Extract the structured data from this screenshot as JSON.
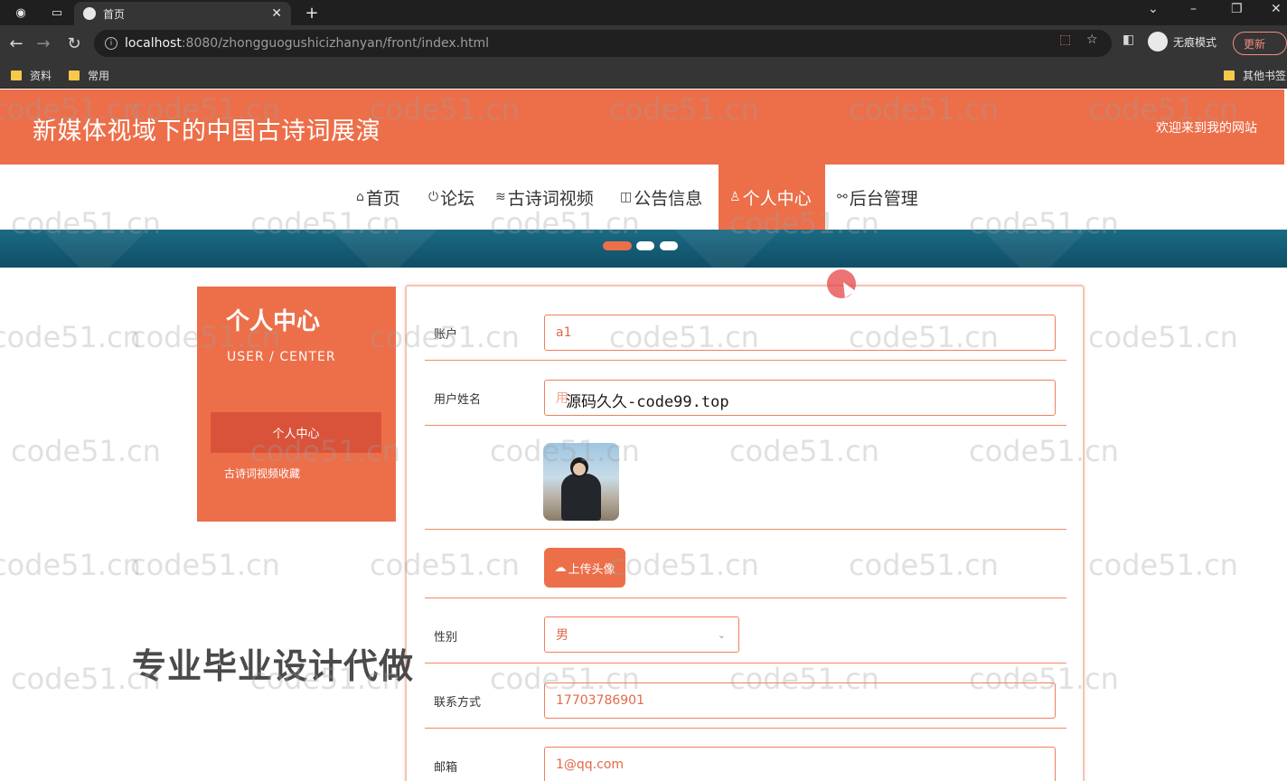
{
  "browser": {
    "tab_title": "首页",
    "url_host": "localhost",
    "url_path": ":8080/zhongguogushicizhanyan/front/index.html",
    "incognito_label": "无痕模式",
    "update_label": "更新",
    "bookmarks": [
      "资料",
      "常用"
    ],
    "other_bookmarks": "其他书签"
  },
  "site": {
    "title": "新媒体视域下的中国古诗词展演",
    "welcome": "欢迎来到我的网站",
    "accent_color": "#ec6f4a"
  },
  "nav": {
    "items": [
      {
        "label": "首页",
        "icon": "home-icon"
      },
      {
        "label": "论坛",
        "icon": "power-icon"
      },
      {
        "label": "古诗词视频",
        "icon": "layers-icon"
      },
      {
        "label": "公告信息",
        "icon": "book-icon"
      },
      {
        "label": "个人中心",
        "icon": "user-icon"
      },
      {
        "label": "后台管理",
        "icon": "link-icon"
      }
    ],
    "active": "个人中心"
  },
  "sidebar": {
    "title": "个人中心",
    "subtitle": "USER / CENTER",
    "items": [
      "个人中心",
      "古诗词视频收藏"
    ]
  },
  "form": {
    "account_label": "账户",
    "account_value": "a1",
    "name_label": "用户姓名",
    "name_value": "用",
    "upload_label": "上传头像",
    "gender_label": "性别",
    "gender_value": "男",
    "phone_label": "联系方式",
    "phone_value": "17703786901",
    "email_label": "邮箱",
    "email_value": "1@qq.com"
  },
  "overlays": {
    "source_text": "源码久久-code99.top",
    "promo_text": "专业毕业设计代做",
    "watermark": "code51.cn"
  }
}
